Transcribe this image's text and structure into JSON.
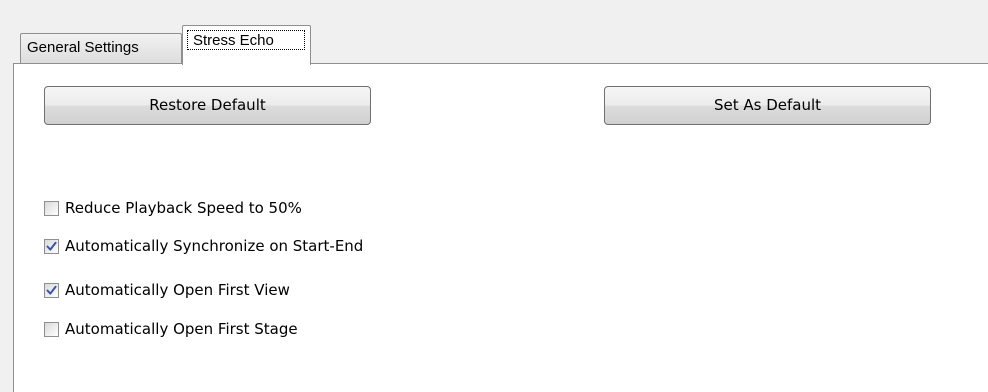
{
  "tabs": [
    {
      "label": "General Settings",
      "active": false
    },
    {
      "label": "Stress Echo",
      "active": true
    }
  ],
  "buttons": {
    "restore_default": "Restore Default",
    "set_as_default": "Set As Default"
  },
  "options": [
    {
      "label": "Reduce Playback Speed to 50%",
      "checked": false
    },
    {
      "label": "Automatically Synchronize on Start-End",
      "checked": true
    },
    {
      "label": "Automatically Open First View",
      "checked": true
    },
    {
      "label": "Automatically Open First Stage",
      "checked": false
    }
  ],
  "colors": {
    "check_mark": "#3a57a7",
    "panel_bg": "#ffffff",
    "window_bg": "#f0f0f0"
  }
}
